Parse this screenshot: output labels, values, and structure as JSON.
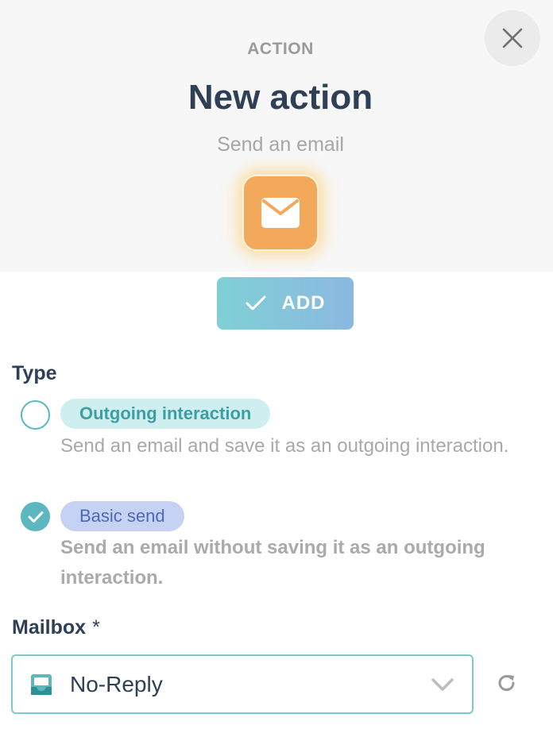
{
  "header": {
    "eyebrow": "ACTION",
    "title": "New action",
    "subtitle": "Send an email",
    "icon": "envelope-icon",
    "icon_color": "#f3a95b"
  },
  "close_button": {
    "icon": "close-icon"
  },
  "add_button": {
    "label": "ADD",
    "icon": "check-icon"
  },
  "type_section": {
    "label": "Type",
    "options": [
      {
        "label": "Outgoing interaction",
        "description": "Send an email and save it as an outgoing interaction.",
        "selected": false
      },
      {
        "label": "Basic send",
        "description": "Send an email without saving it as an outgoing interaction.",
        "selected": true
      }
    ]
  },
  "mailbox": {
    "label": "Mailbox",
    "required_marker": "*",
    "value": "No-Reply",
    "icon": "inbox-icon",
    "refresh_icon": "refresh-icon"
  },
  "colors": {
    "accent": "#5cb8be",
    "title": "#2f3f55",
    "muted": "#a9a9a9"
  }
}
